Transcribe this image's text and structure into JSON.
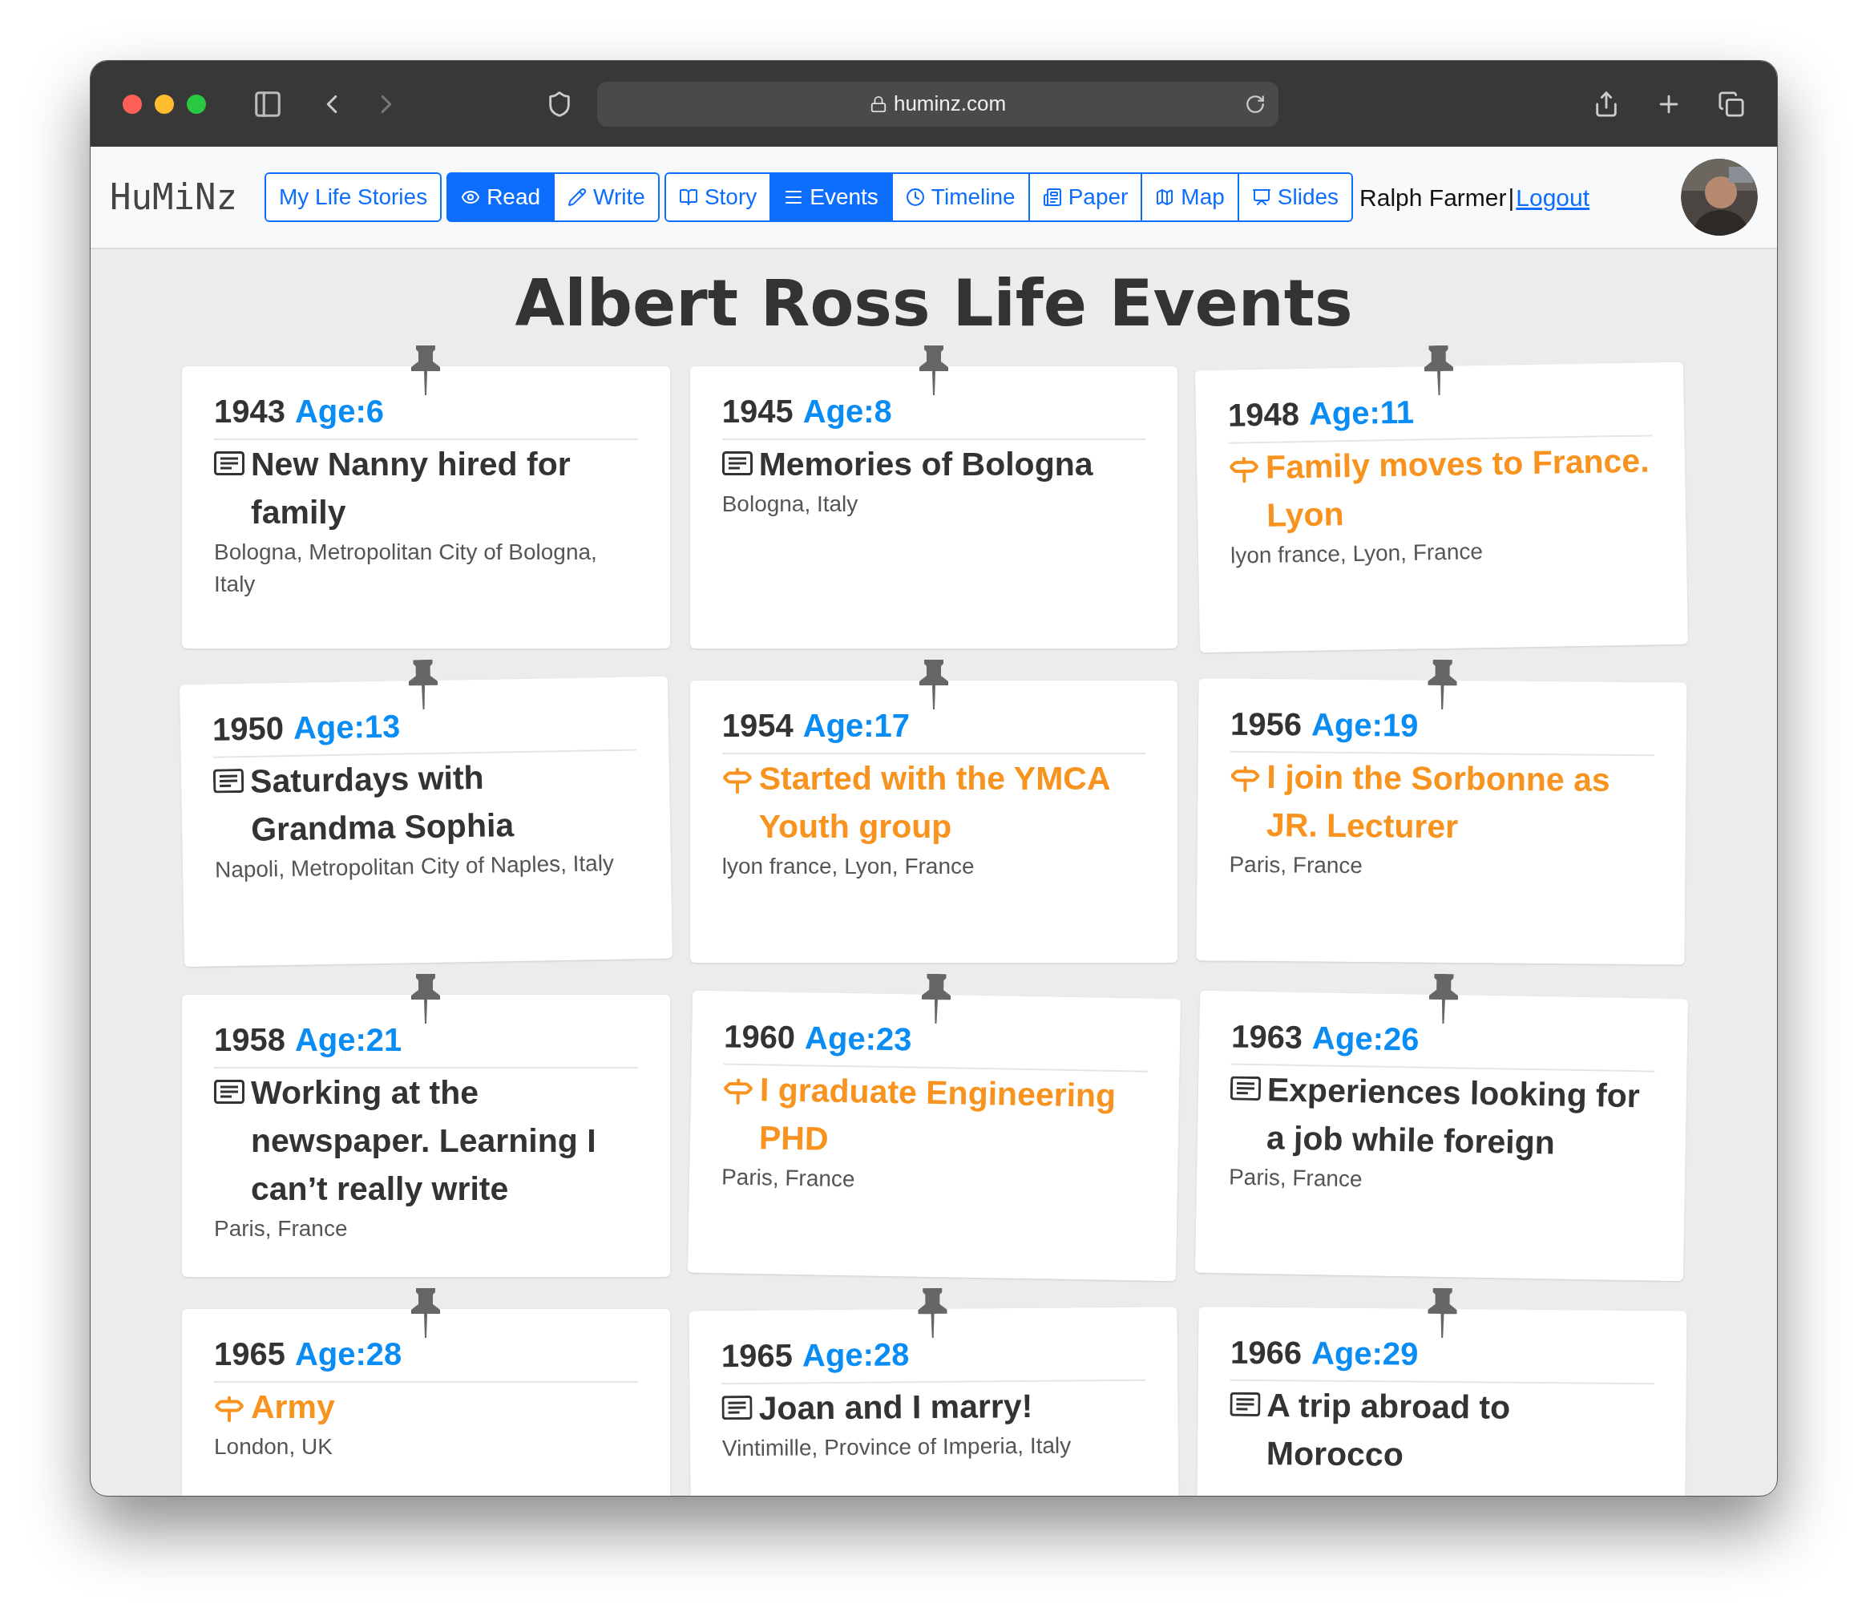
{
  "browser": {
    "url": "huminz.com"
  },
  "header": {
    "logo": "HuMiNz",
    "nav_groups": [
      {
        "items": [
          {
            "label": "My Life Stories",
            "selected": false
          }
        ]
      },
      {
        "items": [
          {
            "label": "Read",
            "kind": "eye",
            "selected": true
          },
          {
            "label": "Write",
            "kind": "pencil",
            "selected": false
          }
        ]
      },
      {
        "items": [
          {
            "label": "Story",
            "kind": "book",
            "selected": false
          },
          {
            "label": "Events",
            "kind": "list",
            "selected": true
          },
          {
            "label": "Timeline",
            "kind": "clock",
            "selected": false
          },
          {
            "label": "Paper",
            "kind": "newspaper",
            "selected": false
          },
          {
            "label": "Map",
            "kind": "map",
            "selected": false
          },
          {
            "label": "Slides",
            "kind": "slides",
            "selected": false
          }
        ]
      }
    ],
    "user": "Ralph Farmer",
    "separator": "|",
    "logout": "Logout"
  },
  "title": "Albert Ross Life Events",
  "events": [
    {
      "year": "1943",
      "age": "Age:6",
      "kind": "story",
      "title": "New Nanny hired for family",
      "place": "Bologna, Metropolitan City of Bologna, Italy"
    },
    {
      "year": "1945",
      "age": "Age:8",
      "kind": "story",
      "title": "Memories of Bologna",
      "place": "Bologna, Italy"
    },
    {
      "year": "1948",
      "age": "Age:11",
      "kind": "event",
      "title": "Family moves to France. Lyon",
      "place": "lyon france, Lyon, France"
    },
    {
      "year": "1950",
      "age": "Age:13",
      "kind": "story",
      "title": "Saturdays with Grandma Sophia",
      "place": "Napoli, Metropolitan City of Naples, Italy"
    },
    {
      "year": "1954",
      "age": "Age:17",
      "kind": "event",
      "title": "Started with the YMCA Youth group",
      "place": "lyon france, Lyon, France"
    },
    {
      "year": "1956",
      "age": "Age:19",
      "kind": "event",
      "title": "I join the Sorbonne as JR. Lecturer",
      "place": "Paris, France"
    },
    {
      "year": "1958",
      "age": "Age:21",
      "kind": "story",
      "title": "Working at the newspaper. Learning I can’t really write",
      "place": "Paris, France"
    },
    {
      "year": "1960",
      "age": "Age:23",
      "kind": "event",
      "title": "I graduate Engineering PHD",
      "place": "Paris, France"
    },
    {
      "year": "1963",
      "age": "Age:26",
      "kind": "story",
      "title": "Experiences looking for a job while foreign",
      "place": "Paris, France"
    },
    {
      "year": "1965",
      "age": "Age:28",
      "kind": "event",
      "title": "Army",
      "place": "London, UK"
    },
    {
      "year": "1965",
      "age": "Age:28",
      "kind": "story",
      "title": "Joan and I marry!",
      "place": "Vintimille, Province of Imperia, Italy"
    },
    {
      "year": "1966",
      "age": "Age:29",
      "kind": "story",
      "title": "A trip abroad to Morocco"
    }
  ]
}
